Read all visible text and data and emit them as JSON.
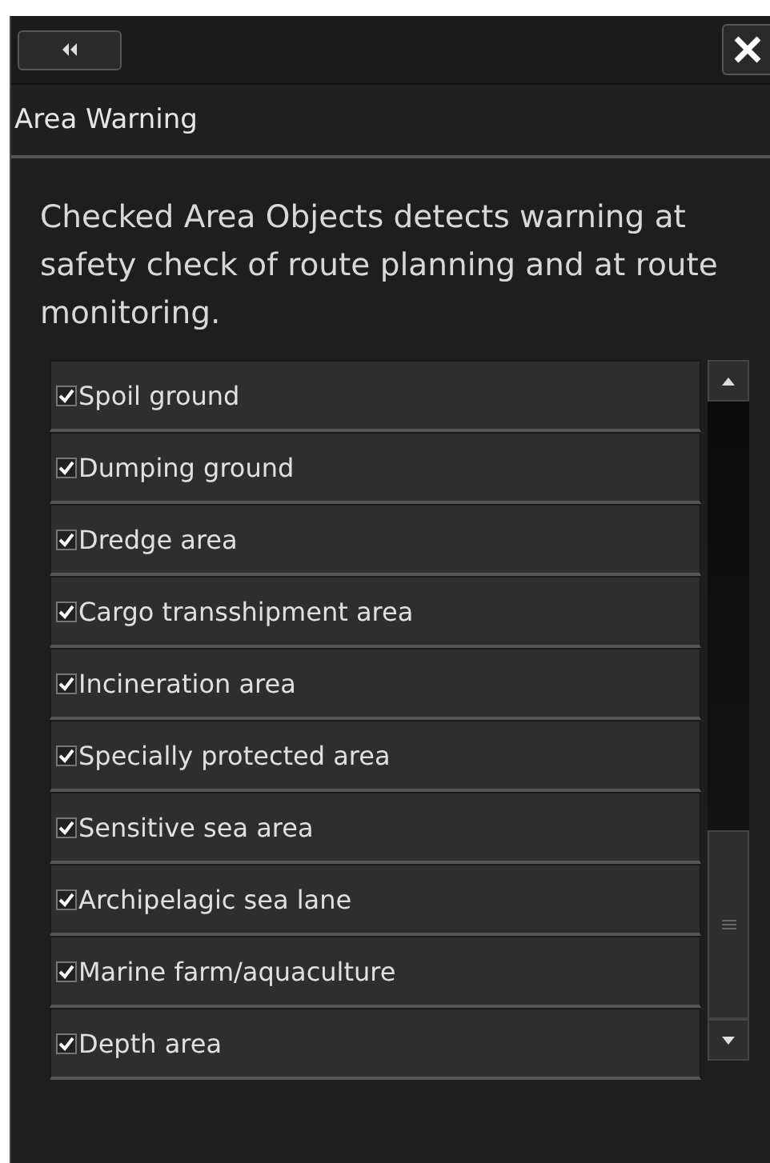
{
  "panel": {
    "title": "Area Warning",
    "description": "Checked Area Objects detects warning at safety check of route planning and at route monitoring."
  },
  "items": [
    {
      "label": "Spoil ground",
      "checked": true
    },
    {
      "label": "Dumping ground",
      "checked": true
    },
    {
      "label": "Dredge area",
      "checked": true
    },
    {
      "label": "Cargo transshipment area",
      "checked": true
    },
    {
      "label": "Incineration area",
      "checked": true
    },
    {
      "label": "Specially protected area",
      "checked": true
    },
    {
      "label": "Sensitive sea area",
      "checked": true
    },
    {
      "label": "Archipelagic sea lane",
      "checked": true
    },
    {
      "label": "Marine farm/aquaculture",
      "checked": true
    },
    {
      "label": "Depth area",
      "checked": true
    }
  ]
}
